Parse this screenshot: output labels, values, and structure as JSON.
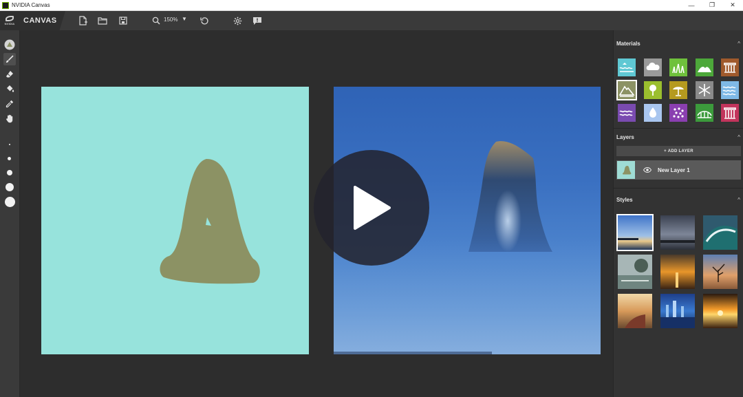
{
  "window": {
    "title": "NVIDIA Canvas",
    "minimize": "—",
    "restore": "❐",
    "close": "✕"
  },
  "brand": {
    "logo_text": "NVIDIA",
    "app_name": "CANVAS"
  },
  "toolbar": {
    "icons": [
      "new-file-icon",
      "open-folder-icon",
      "save-icon",
      "zoom-icon",
      "reset-view-icon",
      "settings-icon",
      "feedback-icon"
    ],
    "zoom_level": "150%",
    "zoom_caret": "▼"
  },
  "tools": [
    "material-picker-icon",
    "brush-icon",
    "eraser-icon",
    "fill-bucket-icon",
    "eyedropper-icon",
    "hand-pan-icon"
  ],
  "active_tool": "brush",
  "brush_sizes": [
    "xs",
    "s",
    "m",
    "l",
    "xl"
  ],
  "colors": {
    "sketch_bg": "#97e3dc",
    "sketch_shape": "#8c9264",
    "accent": "#76b900",
    "panel": "#333333"
  },
  "materials": {
    "title": "Materials",
    "chevron": "^",
    "items": [
      {
        "icon": "sea-icon",
        "color": "#5fc8d3"
      },
      {
        "icon": "cloud-icon",
        "color": "#9a9a9a"
      },
      {
        "icon": "grass-icon",
        "color": "#6fc13c"
      },
      {
        "icon": "hill-icon",
        "color": "#4da83a"
      },
      {
        "icon": "building-icon",
        "color": "#a05a2c"
      },
      {
        "icon": "mountain-icon",
        "color": "#8c9264",
        "selected": true
      },
      {
        "icon": "tree-icon",
        "color": "#9bbf2e"
      },
      {
        "icon": "shrub-icon",
        "color": "#b59a1f"
      },
      {
        "icon": "snow-icon",
        "color": "#8a8a8a"
      },
      {
        "icon": "water-icon",
        "color": "#7fb9e6"
      },
      {
        "icon": "river-icon",
        "color": "#7a4bb0"
      },
      {
        "icon": "fog-icon",
        "color": "#a9c6ef"
      },
      {
        "icon": "flower-icon",
        "color": "#8a3fb0"
      },
      {
        "icon": "bridge-icon",
        "color": "#3c9a3c"
      },
      {
        "icon": "wall-icon",
        "color": "#c2345c"
      }
    ]
  },
  "layers": {
    "title": "Layers",
    "chevron": "^",
    "add_label": "+ ADD LAYER",
    "items": [
      {
        "name": "New Layer 1"
      }
    ]
  },
  "styles": {
    "title": "Styles",
    "chevron": "^",
    "items": [
      {
        "name": "style-1",
        "selected": true
      },
      {
        "name": "style-2"
      },
      {
        "name": "style-3"
      },
      {
        "name": "style-4"
      },
      {
        "name": "style-5"
      },
      {
        "name": "style-6"
      },
      {
        "name": "style-7"
      },
      {
        "name": "style-8"
      },
      {
        "name": "style-9"
      }
    ]
  }
}
